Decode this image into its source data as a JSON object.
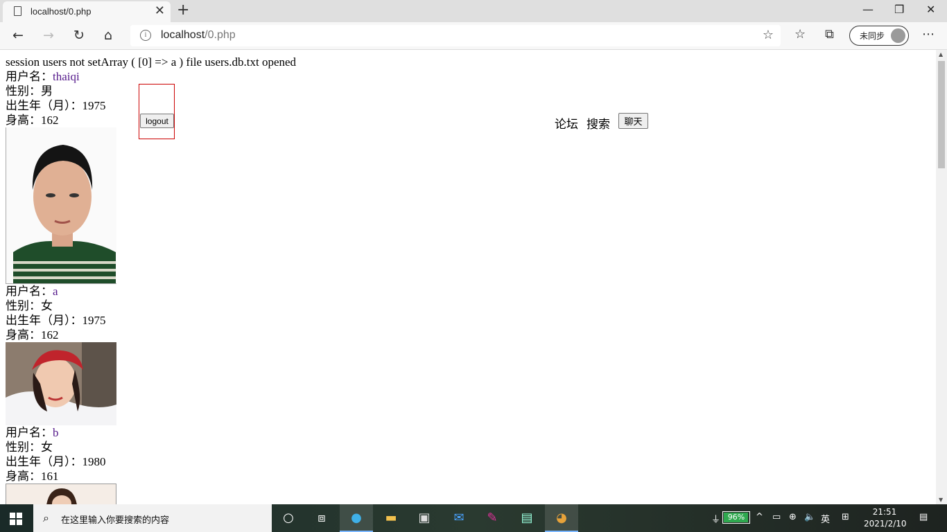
{
  "browser": {
    "tab_title": "localhost/0.php",
    "address_host": "localhost",
    "address_path": "/0.php",
    "sync_label": "未同步"
  },
  "page": {
    "debug_line": "session users not setArray ( [0] => a ) file users.db.txt opened",
    "users": [
      {
        "name_label": "用户名：",
        "name": "thaiqi",
        "gender": "性别：男",
        "birth": "出生年（月）：1975",
        "height": "身高：162"
      },
      {
        "name_label": "用户名：",
        "name": "a",
        "gender": "性别：女",
        "birth": "出生年（月）：1975",
        "height": "身高：162"
      },
      {
        "name_label": "用户名：",
        "name": "b",
        "gender": "性别：女",
        "birth": "出生年（月）：1980",
        "height": "身高：161"
      }
    ],
    "logout_label": "logout",
    "forum_link": "论坛",
    "search_link": "搜索",
    "chat_button": "聊天"
  },
  "taskbar": {
    "search_placeholder": "在这里输入你要搜索的内容",
    "battery": "96%",
    "battery_level": 0.96,
    "ime": "英",
    "time": "21:51",
    "date": "2021/2/10"
  }
}
